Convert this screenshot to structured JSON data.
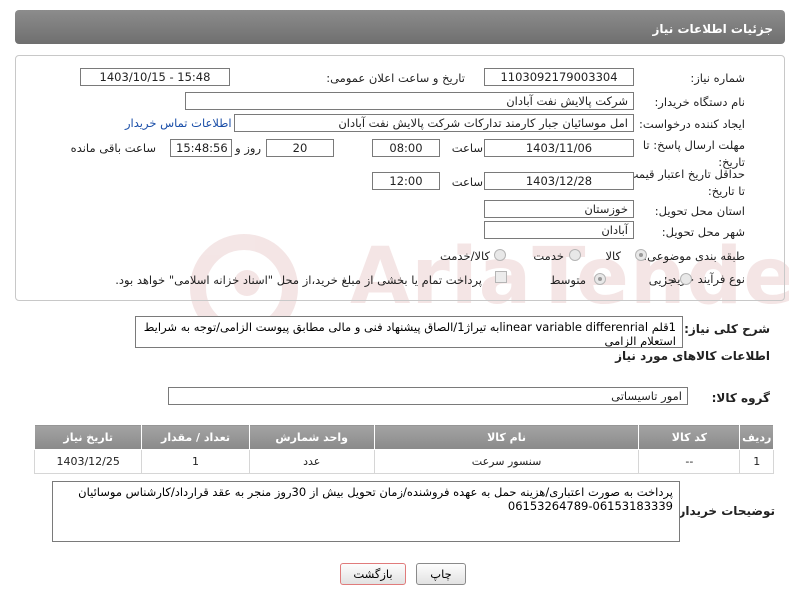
{
  "header": {
    "title": "جزئیات اطلاعات نیاز"
  },
  "watermark": {
    "text": "AriaTender.neT"
  },
  "form": {
    "need_number": {
      "label": "شماره نیاز:",
      "value": "1103092179003304"
    },
    "announce_date": {
      "label": "تاریخ و ساعت اعلان عمومی:",
      "value": "1403/10/15 - 15:48"
    },
    "buyer_org": {
      "label": "نام دستگاه خریدار:",
      "value": "شرکت پالایش نفت آبادان"
    },
    "requester": {
      "label": "ایجاد کننده درخواست:",
      "value": "امل موسائیان جبار کارمند تدارکات شرکت پالایش نفت آبادان",
      "contact_link": "اطلاعات تماس خریدار"
    },
    "reply_deadline": {
      "label": "مهلت ارسال پاسخ: تا تاریخ:",
      "date": "1403/11/06",
      "time_label": "ساعت",
      "time": "08:00",
      "days": "20",
      "days_label": "روز و",
      "remaining": "15:48:56",
      "remaining_label": "ساعت باقی مانده"
    },
    "price_validity": {
      "label": "حداقل تاریخ اعتبار قیمت: تا تاریخ:",
      "date": "1403/12/28",
      "time_label": "ساعت",
      "time": "12:00"
    },
    "province": {
      "label": "استان محل تحویل:",
      "value": "خوزستان"
    },
    "city": {
      "label": "شهر محل تحویل:",
      "value": "آبادان"
    },
    "category": {
      "label": "طبقه بندی موضوعی:",
      "options": [
        "کالا",
        "خدمت",
        "کالا/خدمت"
      ],
      "selected": "کالا"
    },
    "purchase_type": {
      "label": "نوع فرآیند خرید :",
      "options": [
        "جزیی",
        "متوسط"
      ],
      "selected": "متوسط",
      "payment_note": "پرداخت تمام یا بخشی از مبلغ خرید،از محل \"اسناد خزانه اسلامی\" خواهد بود."
    }
  },
  "need_summary": {
    "label": "شرح کلی نیاز:",
    "value": "1قلم linear variable differenrialبه تیراژ1/الصاق پیشنهاد فنی و مالی مطابق پیوست الزامی/توجه به شرایط استعلام الزامی"
  },
  "goods_info": {
    "title": "اطلاعات کالاهای مورد نیاز",
    "group_label": "گروه کالا:",
    "group_value": "امور تاسیساتی",
    "table": {
      "headers": [
        "ردیف",
        "کد کالا",
        "نام کالا",
        "واحد شمارش",
        "تعداد / مقدار",
        "تاریخ نیاز"
      ],
      "rows": [
        [
          "1",
          "--",
          "سنسور سرعت",
          "عدد",
          "1",
          "1403/12/25"
        ]
      ]
    }
  },
  "buyer_notes": {
    "label": "توضیحات خریدار:",
    "value": "پرداخت به صورت اعتباری/هزینه حمل به عهده فروشنده/زمان تحویل بیش از 30روز منجر به عقد قرارداد/کارشناس موسائیان 06153183339-06153264789"
  },
  "buttons": {
    "print": "چاپ",
    "back": "بازگشت"
  },
  "colors": {
    "header_bg": "#7d7d7d",
    "link": "#1a4ea8",
    "back_border": "#e07b7b"
  }
}
